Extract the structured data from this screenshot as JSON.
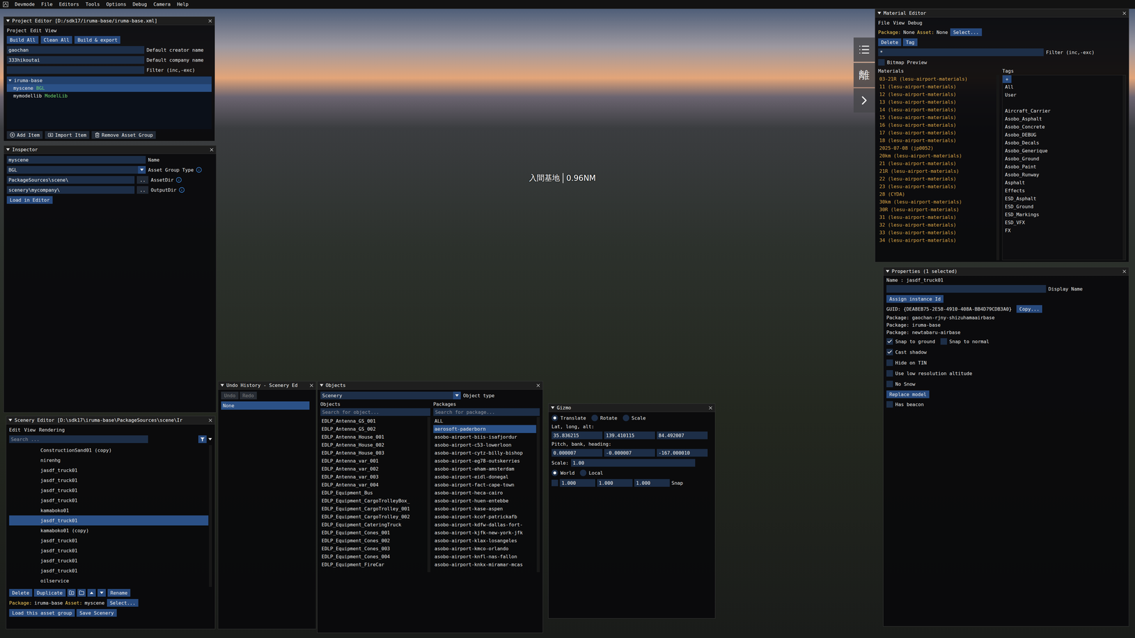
{
  "menubar": {
    "items": [
      "Devmode",
      "File",
      "Editors",
      "Tools",
      "Options",
      "Debug",
      "Camera",
      "Help"
    ]
  },
  "scene": {
    "label": "入間基地",
    "distance": "0.96NM"
  },
  "side_buttons": [
    {
      "kind": "list"
    },
    {
      "kind": "text",
      "text": "離"
    },
    {
      "kind": "arrow"
    }
  ],
  "project_editor": {
    "title": "Project Editor [D:/sdk17/iruma-base/iruma-base.xml]",
    "menu": [
      "Project",
      "Edit",
      "View"
    ],
    "buttons": [
      "Build All",
      "Clean All",
      "Build & export"
    ],
    "fields": [
      {
        "value": "gaochan",
        "label": "Default creator name"
      },
      {
        "value": "333hikoutai",
        "label": "Default company name"
      },
      {
        "value": "",
        "label": "Filter (inc,-exc)"
      }
    ],
    "tree": {
      "label": "iruma-base",
      "expanded": true,
      "children": [
        {
          "name": "myscene",
          "tag": "BGL",
          "selected": true
        },
        {
          "name": "mymodellib",
          "tag": "ModelLib",
          "selected": false
        }
      ]
    },
    "actions": [
      "Add Item",
      "Import Item",
      "Remove Asset Group"
    ]
  },
  "inspector": {
    "title": "Inspector",
    "fields": [
      {
        "kind": "text",
        "value": "myscene",
        "label": "Name",
        "info": false
      },
      {
        "kind": "select",
        "value": "BGL",
        "label": "Asset Group Type",
        "info": true
      },
      {
        "kind": "path",
        "value": "PackageSources\\scene\\",
        "browse": "..",
        "label": "AssetDir",
        "info": true
      },
      {
        "kind": "path",
        "value": "scenery\\mycompany\\",
        "browse": "..",
        "label": "OutputDir",
        "info": true
      }
    ],
    "button": "Load in Editor"
  },
  "scenery_editor": {
    "title": "Scenery Editor [D:\\sdk17\\iruma-base\\PackageSources\\scene\\Ir",
    "menu": [
      "Edit",
      "View",
      "Rendering"
    ],
    "search_placeholder": "Search ...",
    "items": [
      {
        "name": "ConstructionSand01 (copy)",
        "selected": false
      },
      {
        "name": "nirenhg",
        "selected": false
      },
      {
        "name": "jasdf_truck01",
        "selected": false
      },
      {
        "name": "jasdf_truck01",
        "selected": false
      },
      {
        "name": "jasdf_truck01",
        "selected": false
      },
      {
        "name": "jasdf_truck01",
        "selected": false
      },
      {
        "name": "kamaboko01",
        "selected": false
      },
      {
        "name": "jasdf_truck01",
        "selected": true
      },
      {
        "name": "kamaboko01 (copy)",
        "selected": false
      },
      {
        "name": "jasdf_truck01",
        "selected": false
      },
      {
        "name": "jasdf_truck01",
        "selected": false
      },
      {
        "name": "jasdf_truck01",
        "selected": false
      },
      {
        "name": "jasdf_truck01",
        "selected": false
      },
      {
        "name": "oilservice",
        "selected": false
      }
    ],
    "buttons": [
      "Delete",
      "Duplicate"
    ],
    "rename": "Rename",
    "footer": {
      "package_label": "Package:",
      "package": "iruma-base",
      "asset_label": "Asset:",
      "asset": "myscene",
      "select": "Select..."
    },
    "actions": [
      "Load this asset group",
      "Save Scenery"
    ]
  },
  "undo_history": {
    "title": "Undo History - Scenery Ed",
    "buttons": [
      {
        "label": "Undo",
        "disabled": true
      },
      {
        "label": "Redo",
        "disabled": true
      }
    ],
    "entries": [
      {
        "label": "None",
        "selected": true
      }
    ]
  },
  "objects": {
    "title": "Objects",
    "type": {
      "value": "Scenery",
      "label": "Object type"
    },
    "objects": {
      "header": "Objects",
      "placeholder": "Search for object...",
      "items": [
        {
          "name": "EDLP_Antenna_GS_001",
          "selected": false
        },
        {
          "name": "EDLP_Antenna_GS_002",
          "selected": false
        },
        {
          "name": "EDLP_Antenna_House_001",
          "selected": false
        },
        {
          "name": "EDLP_Antenna_House_002",
          "selected": false
        },
        {
          "name": "EDLP_Antenna_House_003",
          "selected": false
        },
        {
          "name": "EDLP_Antenna_var_001",
          "selected": false
        },
        {
          "name": "EDLP_Antenna_var_002",
          "selected": false
        },
        {
          "name": "EDLP_Antenna_var_003",
          "selected": false
        },
        {
          "name": "EDLP_Antenna_var_004",
          "selected": false
        },
        {
          "name": "EDLP_Equipment_Bus",
          "selected": false
        },
        {
          "name": "EDLP_Equipment_CargoTrolleyBox_",
          "selected": false
        },
        {
          "name": "EDLP_Equipment_CargoTrolley_001",
          "selected": false
        },
        {
          "name": "EDLP_Equipment_CargoTrolley_002",
          "selected": false
        },
        {
          "name": "EDLP_Equipment_CateringTruck",
          "selected": false
        },
        {
          "name": "EDLP_Equipment_Cones_001",
          "selected": false
        },
        {
          "name": "EDLP_Equipment_Cones_002",
          "selected": false
        },
        {
          "name": "EDLP_Equipment_Cones_003",
          "selected": false
        },
        {
          "name": "EDLP_Equipment_Cones_004",
          "selected": false
        },
        {
          "name": "EDLP_Equipment_FireCar",
          "selected": false
        }
      ]
    },
    "packages": {
      "header": "Packages",
      "placeholder": "Search for package...",
      "items": [
        {
          "name": "ALL",
          "selected": false
        },
        {
          "name": "aerosoft-paderborn",
          "selected": true
        },
        {
          "name": "asobo-airport-biis-isafjordur",
          "selected": false
        },
        {
          "name": "asobo-airport-c53-lowerloon",
          "selected": false
        },
        {
          "name": "asobo-airport-cytz-billy-bishop",
          "selected": false
        },
        {
          "name": "asobo-airport-eg78-outskerries",
          "selected": false
        },
        {
          "name": "asobo-airport-eham-amsterdam",
          "selected": false
        },
        {
          "name": "asobo-airport-eidl-donegal",
          "selected": false
        },
        {
          "name": "asobo-airport-fact-cape-town",
          "selected": false
        },
        {
          "name": "asobo-airport-heca-cairo",
          "selected": false
        },
        {
          "name": "asobo-airport-huen-entebbe",
          "selected": false
        },
        {
          "name": "asobo-airport-kase-aspen",
          "selected": false
        },
        {
          "name": "asobo-airport-kcof-patrickafb",
          "selected": false
        },
        {
          "name": "asobo-airport-kdfw-dallas-fort-",
          "selected": false
        },
        {
          "name": "asobo-airport-kjfk-new-york-jfk",
          "selected": false
        },
        {
          "name": "asobo-airport-klax-losangeles",
          "selected": false
        },
        {
          "name": "asobo-airport-kmco-orlando",
          "selected": false
        },
        {
          "name": "asobo-airport-knfl-nas-fallon",
          "selected": false
        },
        {
          "name": "asobo-airport-knkx-miramar-mcas",
          "selected": false
        }
      ]
    }
  },
  "gizmo": {
    "title": "Gizmo",
    "modes": [
      {
        "label": "Translate",
        "selected": true
      },
      {
        "label": "Rotate",
        "selected": false
      },
      {
        "label": "Scale",
        "selected": false
      }
    ],
    "position": {
      "label": "Lat, long, alt:",
      "values": [
        "35.836215",
        "139.410115",
        "84.492007"
      ]
    },
    "rotation": {
      "label": "Pitch, bank, heading:",
      "values": [
        "0.000007",
        "-0.000007",
        "-167.000010"
      ]
    },
    "scale": {
      "label": "Scale:",
      "value": "1.00"
    },
    "spaces": [
      {
        "label": "World",
        "selected": true
      },
      {
        "label": "Local",
        "selected": false
      }
    ],
    "snap": {
      "checked": false,
      "values": [
        "1.000",
        "1.000",
        "1.000"
      ],
      "label": "Snap"
    }
  },
  "material_editor": {
    "title": "Material Editor",
    "menu": [
      "File",
      "View",
      "Debug"
    ],
    "package_label": "Package:",
    "package": "None",
    "asset_label": "Asset:",
    "asset": "None",
    "select": "Select...",
    "buttons": [
      "Delete",
      "Tag"
    ],
    "filter": {
      "value": "*",
      "label": "Filter (inc,-exc)"
    },
    "bitmap_preview": {
      "label": "Bitmap Preview",
      "checked": false
    },
    "materials": {
      "header": "Materials",
      "items": [
        "03-21R (lesu-airport-materials)",
        "11 (lesu-airport-materials)",
        "12 (lesu-airport-materials)",
        "13 (lesu-airport-materials)",
        "14 (lesu-airport-materials)",
        "15 (lesu-airport-materials)",
        "16 (lesu-airport-materials)",
        "17 (lesu-airport-materials)",
        "18 (lesu-airport-materials)",
        "2025-07-08 (jp0052)",
        "20km (lesu-airport-materials)",
        "21 (lesu-airport-materials)",
        "21R (lesu-airport-materials)",
        "22 (lesu-airport-materials)",
        "23 (lesu-airport-materials)",
        "28 (CYDA)",
        "30km (lesu-airport-materials)",
        "30R (lesu-airport-materials)",
        "31 (lesu-airport-materials)",
        "32 (lesu-airport-materials)",
        "33 (lesu-airport-materials)",
        "34 (lesu-airport-materials)"
      ]
    },
    "tags": {
      "header": "Tags",
      "add": "+",
      "groups": [
        [
          "All",
          "User"
        ],
        [
          "Aircraft_Carrier",
          "Asobo_Asphalt",
          "Asobo_Concrete",
          "Asobo_DEBUG",
          "Asobo_Decals",
          "Asobo_Generique",
          "Asobo_Ground",
          "Asobo_Paint",
          "Asobo_Runway",
          "Asphalt",
          "Effects",
          "ESD_Asphalt",
          "ESD_Ground",
          "ESD_Markings",
          "ESD_VFX",
          "FX"
        ]
      ]
    }
  },
  "properties": {
    "title": "Properties (1 selected)",
    "name": "Name : jasdf_truck01",
    "display_name": {
      "value": "",
      "label": "Display Name"
    },
    "assign": "Assign instance Id",
    "guid": "GUID: {DEA8EB75-2E58-4910-408A-BB4D79CDB3A0}",
    "copy": "Copy...",
    "packages": [
      "Package: gaochan-rjny-shizuhamaairbase",
      "Package: iruma-base",
      "Package: newtabaru-airbase"
    ],
    "option_rows": [
      [
        {
          "label": "Snap to ground",
          "checked": true
        },
        {
          "label": "Snap to normal",
          "checked": false
        }
      ],
      [
        {
          "label": "Cast shadow",
          "checked": true
        }
      ],
      [
        {
          "label": "Hide on TIN",
          "checked": false
        }
      ],
      [
        {
          "label": "Use low resolution altitude",
          "checked": false
        }
      ],
      [
        {
          "label": "No Snow",
          "checked": false
        }
      ]
    ],
    "replace": "Replace model",
    "beacon": {
      "label": "Has beacon",
      "checked": false
    }
  }
}
